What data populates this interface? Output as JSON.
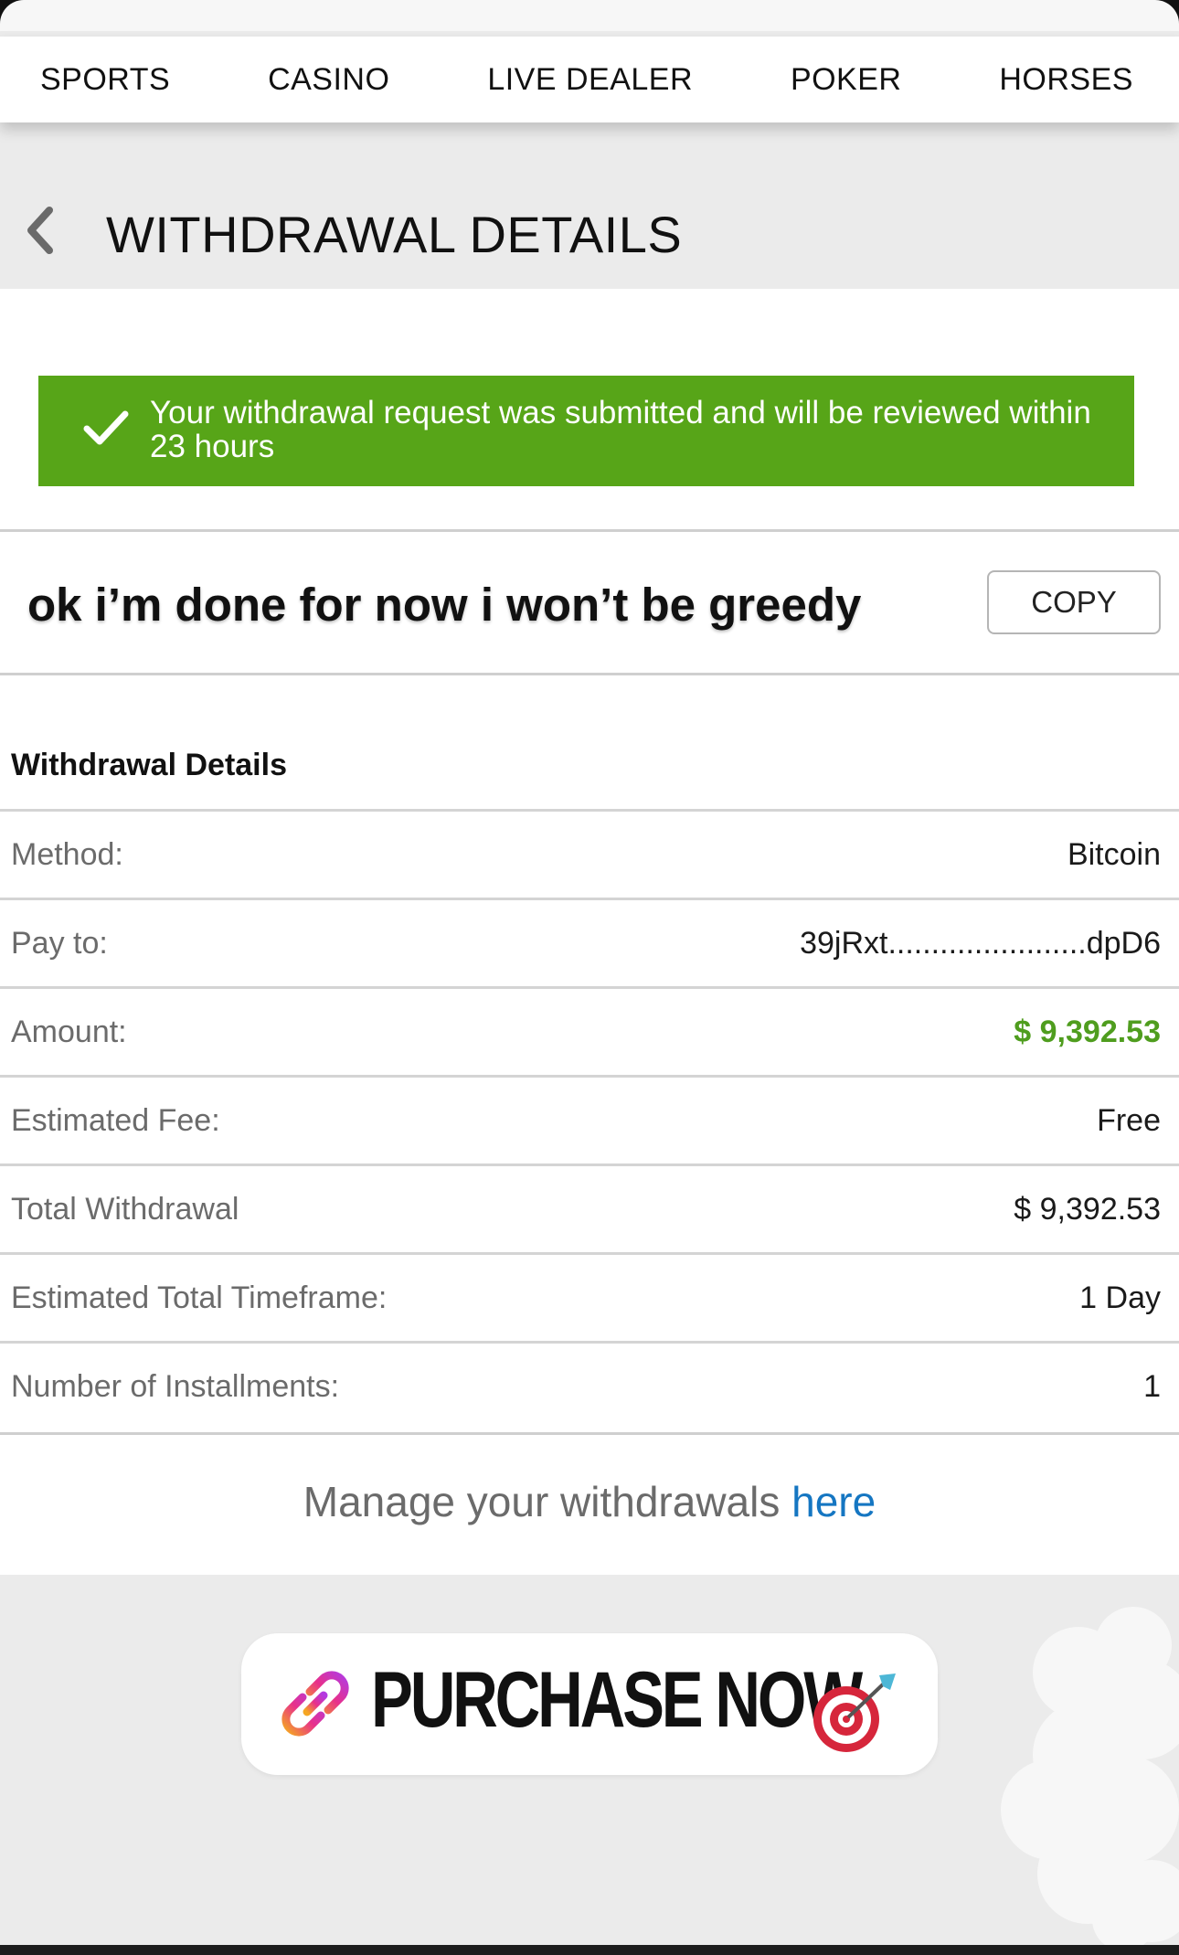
{
  "nav": {
    "items": [
      "SPORTS",
      "CASINO",
      "LIVE DEALER",
      "POKER",
      "HORSES"
    ]
  },
  "header": {
    "back_icon": "chevron-left-icon",
    "title": "WITHDRAWAL DETAILS"
  },
  "banner": {
    "icon": "checkmark-icon",
    "message": "Your withdrawal request was submitted and will be reviewed within 23 hours",
    "color": "#57a518"
  },
  "caption": {
    "text": "ok i’m done for now i won’t be greedy",
    "copy_label": "COPY"
  },
  "details": {
    "title": "Withdrawal Details",
    "rows": [
      {
        "label": "Method:",
        "value": "Bitcoin"
      },
      {
        "label": "Pay to:",
        "value": "39jRxt.......................dpD6"
      },
      {
        "label": "Amount:",
        "value": "$ 9,392.53"
      },
      {
        "label": "Estimated Fee:",
        "value": "Free"
      },
      {
        "label": "Total Withdrawal",
        "value": "$ 9,392.53"
      },
      {
        "label": "Estimated Total Timeframe:",
        "value": "1 Day"
      },
      {
        "label": "Number of Installments:",
        "value": "1"
      }
    ],
    "amount_color": "#4f9d1e"
  },
  "manage": {
    "text": "Manage your withdrawals ",
    "link": "here",
    "link_color": "#1576c2"
  },
  "sticker": {
    "text": "PURCHASE NOW",
    "left_icon": "link-icon",
    "right_icon": "dart-target-icon"
  }
}
